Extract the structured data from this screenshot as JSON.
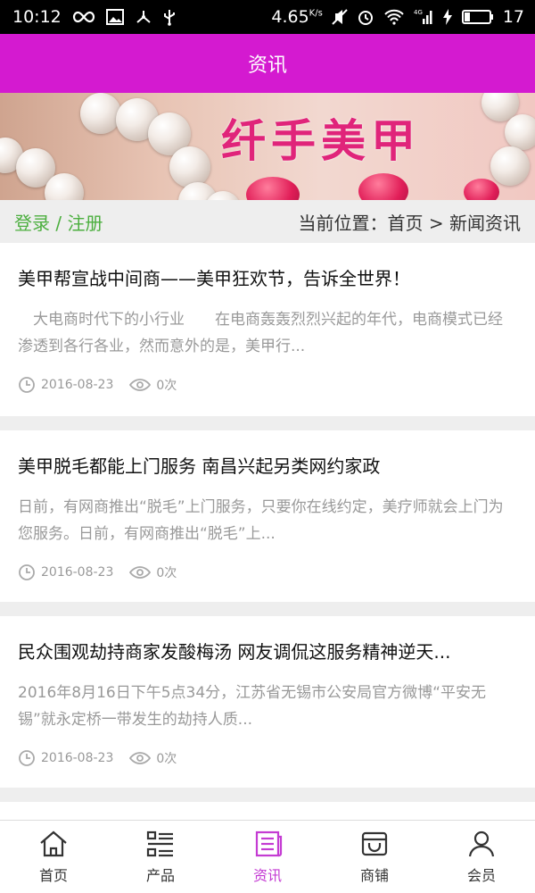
{
  "status_bar": {
    "time": "10:12",
    "net_speed": "4.65",
    "net_speed_unit": "K/s",
    "battery": "17",
    "network_type": "4G",
    "icons": [
      "infinity-icon",
      "image-icon",
      "share-icon",
      "usb-icon",
      "mute-icon",
      "alarm-icon",
      "wifi-icon",
      "signal-icon",
      "charging-icon",
      "battery-icon"
    ]
  },
  "header": {
    "title": "资讯"
  },
  "banner": {
    "title": "纤手美甲"
  },
  "crumb": {
    "login": "登录",
    "sep": " / ",
    "register": "注册",
    "position": "当前位置：首页 > 新闻资讯"
  },
  "articles": [
    {
      "title": "美甲帮宣战中间商——美甲狂欢节，告诉全世界！",
      "desc": "　大电商时代下的小行业　　在电商轰轰烈烈兴起的年代，电商模式已经渗透到各行各业，然而意外的是，美甲行...",
      "date": "2016-08-23",
      "views": "0次"
    },
    {
      "title": "美甲脱毛都能上门服务 南昌兴起另类网约家政",
      "desc": "日前，有网商推出“脱毛”上门服务，只要你在线约定，美疗师就会上门为您服务。日前，有网商推出“脱毛”上...",
      "date": "2016-08-23",
      "views": "0次"
    },
    {
      "title": "民众围观劫持商家发酸梅汤 网友调侃这服务精神逆天...",
      "desc": "2016年8月16日下午5点34分，江苏省无锡市公安局官方微博“平安无锡”就永定桥一带发生的劫持人质...",
      "date": "2016-08-23",
      "views": "0次"
    }
  ],
  "tabbar": {
    "items": [
      {
        "label": "首页",
        "icon": "home-icon"
      },
      {
        "label": "产品",
        "icon": "list-icon"
      },
      {
        "label": "资讯",
        "icon": "news-icon",
        "active": true
      },
      {
        "label": "商铺",
        "icon": "store-icon"
      },
      {
        "label": "会员",
        "icon": "user-icon"
      }
    ]
  },
  "colors": {
    "header_bg": "#d41ad0",
    "tab_active": "#c43bd3",
    "login_link": "#4caf3f"
  }
}
